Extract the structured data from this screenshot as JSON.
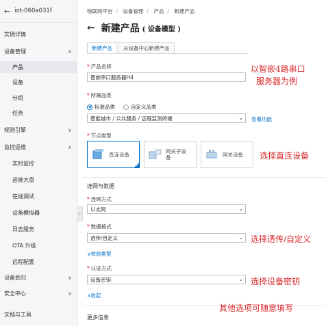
{
  "sidebar": {
    "instance": "iot-060a031f",
    "items": [
      {
        "label": "实例详情",
        "level": 1,
        "chev": ""
      },
      {
        "label": "设备管理",
        "level": 1,
        "chev": "∧"
      },
      {
        "label": "产品",
        "level": 2,
        "chev": "",
        "active": true
      },
      {
        "label": "设备",
        "level": 2,
        "chev": ""
      },
      {
        "label": "分组",
        "level": 2,
        "chev": ""
      },
      {
        "label": "任务",
        "level": 2,
        "chev": ""
      },
      {
        "label": "规则引擎",
        "level": 1,
        "chev": "∨"
      },
      {
        "label": "监控运维",
        "level": 1,
        "chev": "∧"
      },
      {
        "label": "实时监控",
        "level": 2,
        "chev": ""
      },
      {
        "label": "运维大盘",
        "level": 2,
        "chev": ""
      },
      {
        "label": "在线调试",
        "level": 2,
        "chev": ""
      },
      {
        "label": "设备模拟器",
        "level": 2,
        "chev": ""
      },
      {
        "label": "日志服务",
        "level": 2,
        "chev": ""
      },
      {
        "label": "OTA 升级",
        "level": 2,
        "chev": ""
      },
      {
        "label": "远程配置",
        "level": 2,
        "chev": ""
      },
      {
        "label": "设备划归",
        "level": 1,
        "chev": "∨"
      },
      {
        "label": "安全中心",
        "level": 1,
        "chev": "∨"
      },
      {
        "label": "文档与工具",
        "level": 1,
        "chev": ""
      }
    ]
  },
  "breadcrumb": [
    "物联网平台",
    "设备管理",
    "产品",
    "新建产品"
  ],
  "header": {
    "title": "新建产品",
    "subtitle": "( 设备模型 )"
  },
  "tabs": [
    "新建产品",
    "从设备中心新建产品"
  ],
  "form": {
    "product_name_label": "产品名称",
    "product_name_value": "智嵌串口服务器H4",
    "category_label": "所属品类",
    "radio_standard": "标准品类",
    "radio_custom": "自定义品类",
    "category_value": "智能城市 / 公共服务 / 远程监测终端",
    "view_function_link": "查看功能",
    "node_type_label": "节点类型",
    "node_types": [
      "直连设备",
      "网关子设备",
      "网关设备"
    ],
    "network_section": "连网与数据",
    "network_label": "连网方式",
    "network_value": "以太网",
    "data_format_label": "数据格式",
    "data_format_value": "透传/自定义",
    "verify_link": "∨校验类型",
    "auth_label": "认证方式",
    "auth_value": "设备密钥",
    "collapse_link": "∧收起",
    "more_info": "更多信息"
  },
  "annotations": {
    "name_line1": "以智嵌4路串口",
    "name_line2": "服务器为例",
    "direct": "选择直连设备",
    "transparent": "选择透传/自定义",
    "secret": "选择设备密钥",
    "other": "其他选项可随意填写"
  },
  "colors": {
    "accent": "#0070cc",
    "annotation": "#d9282b",
    "sidebar_bg": "#f5f6f7"
  }
}
